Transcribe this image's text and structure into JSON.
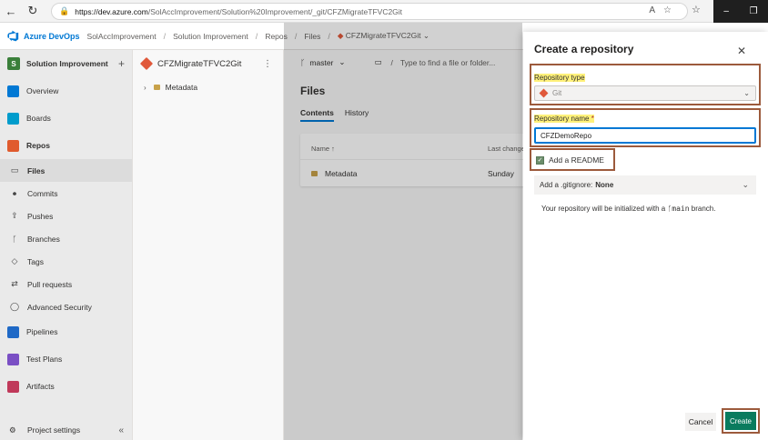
{
  "browser": {
    "url_host": "https://dev.azure.com",
    "url_path": "/SolAccImprovement/Solution%20Improvement/_git/CFZMigrateTFVC2Git"
  },
  "header": {
    "app_name": "Azure DevOps",
    "breadcrumbs": [
      "SolAccImprovement",
      "Solution Improvement",
      "Repos",
      "Files",
      "CFZMigrateTFVC2Git"
    ]
  },
  "sidebar": {
    "project_badge": "S",
    "project_name": "Solution Improvement",
    "items": [
      {
        "label": "Overview",
        "color": "#0078d4"
      },
      {
        "label": "Boards",
        "color": "#009ccc"
      },
      {
        "label": "Repos",
        "color": "#e05b2d"
      },
      {
        "label": "Files"
      },
      {
        "label": "Commits"
      },
      {
        "label": "Pushes"
      },
      {
        "label": "Branches"
      },
      {
        "label": "Tags"
      },
      {
        "label": "Pull requests"
      },
      {
        "label": "Advanced Security"
      },
      {
        "label": "Pipelines",
        "color": "#1f69c6"
      },
      {
        "label": "Test Plans",
        "color": "#7a4fc4"
      },
      {
        "label": "Artifacts",
        "color": "#c0395a"
      }
    ],
    "footer": "Project settings"
  },
  "tree": {
    "repo_name": "CFZMigrateTFVC2Git",
    "folder": "Metadata"
  },
  "main": {
    "branch": "master",
    "path_placeholder": "Type to find a file or folder...",
    "title": "Files",
    "tabs": [
      "Contents",
      "History"
    ],
    "table": {
      "col_name": "Name ↑",
      "col_last_change": "Last change",
      "rows": [
        {
          "name": "Metadata",
          "last_change": "Sunday"
        }
      ]
    }
  },
  "dialog": {
    "title": "Create a repository",
    "repo_type_label": "Repository type",
    "repo_type_value": "Git",
    "repo_name_label": "Repository name",
    "repo_name_required": "*",
    "repo_name_value": "CFZDemoRepo",
    "readme_label": "Add a README",
    "gitignore_label": "Add a .gitignore:",
    "gitignore_value": "None",
    "info_prefix": "Your repository will be initialized with a",
    "info_branch": "main",
    "info_suffix": "branch.",
    "cancel": "Cancel",
    "create": "Create"
  }
}
